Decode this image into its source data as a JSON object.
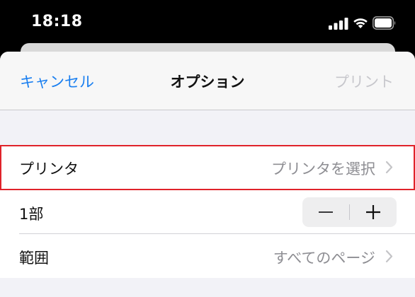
{
  "status_bar": {
    "time": "18:18",
    "icons": [
      "signal-icon",
      "wifi-icon",
      "battery-icon"
    ]
  },
  "nav": {
    "cancel_label": "キャンセル",
    "title": "オプション",
    "print_label": "プリント"
  },
  "rows": {
    "printer": {
      "label": "プリンタ",
      "value": "プリンタを選択"
    },
    "copies": {
      "label": "1部"
    },
    "range": {
      "label": "範囲",
      "value": "すべてのページ"
    }
  },
  "colors": {
    "accent": "#1a7ff0",
    "disabled": "#c7c7cc",
    "highlight_outline": "#e0232a"
  }
}
